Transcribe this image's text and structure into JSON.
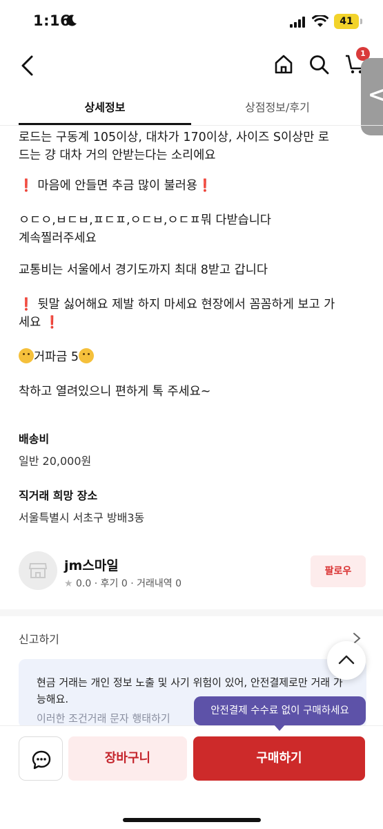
{
  "status_bar": {
    "time": "1:16",
    "battery": "41"
  },
  "header": {
    "cart_badge": "1"
  },
  "side_handle": {
    "glyph": "<"
  },
  "tabs": [
    {
      "label": "상세정보",
      "active": true
    },
    {
      "label": "상점정보/후기",
      "active": false
    }
  ],
  "description": {
    "line_1": "로드는 구동계 105이상, 대차가 170이상, 사이즈 S이상만 로",
    "line_2": "드는 걍 대차 거의 안받는다는 소리에요",
    "line_3": "마음에 안들면 추금 많이 불러용",
    "line_4": "ㅇㄷㅇ,ㅂㄷㅂ,ㅍㄷㅍ,ㅇㄷㅂ,ㅇㄷㅍ뭐 다받습니다",
    "line_5": "계속찔러주세요",
    "line_6": "교통비는 서울에서 경기도까지 최대 8받고 갑니다",
    "line_7": "뒷말 싫어해요 제발 하지 마세요 현장에서 꼼꼼하게 보고 가",
    "line_8": "세요",
    "line_9": "거파금 5",
    "line_10": "착하고 열려있으니 편하게 톡 주세요~",
    "warn_mark": "❗"
  },
  "shipping": {
    "label": "배송비",
    "value": "일반 20,000원"
  },
  "location": {
    "label": "직거래 희망 장소",
    "value": "서울특별시 서초구 방배3동"
  },
  "seller": {
    "name": "jm스마일",
    "rating": "0.0",
    "reviews": "후기 0",
    "trades": "거래내역 0",
    "follow_label": "팔로우"
  },
  "report": {
    "label": "신고하기"
  },
  "notice": {
    "text": "현금 거래는 개인 정보 노출 및 사기 위험이 있어, 안전결제로만 거래 가능해요.",
    "faded_text": "이러한 조건거래 문자 행태하기"
  },
  "tooltip": {
    "text": "안전결제 수수료 없이 구매하세요"
  },
  "actions": {
    "cart_label": "장바구니",
    "buy_label": "구매하기"
  },
  "colors": {
    "accent_red": "#cd2a2a",
    "tooltip_purple": "#5d52a8",
    "battery_yellow": "#f2d32b"
  }
}
